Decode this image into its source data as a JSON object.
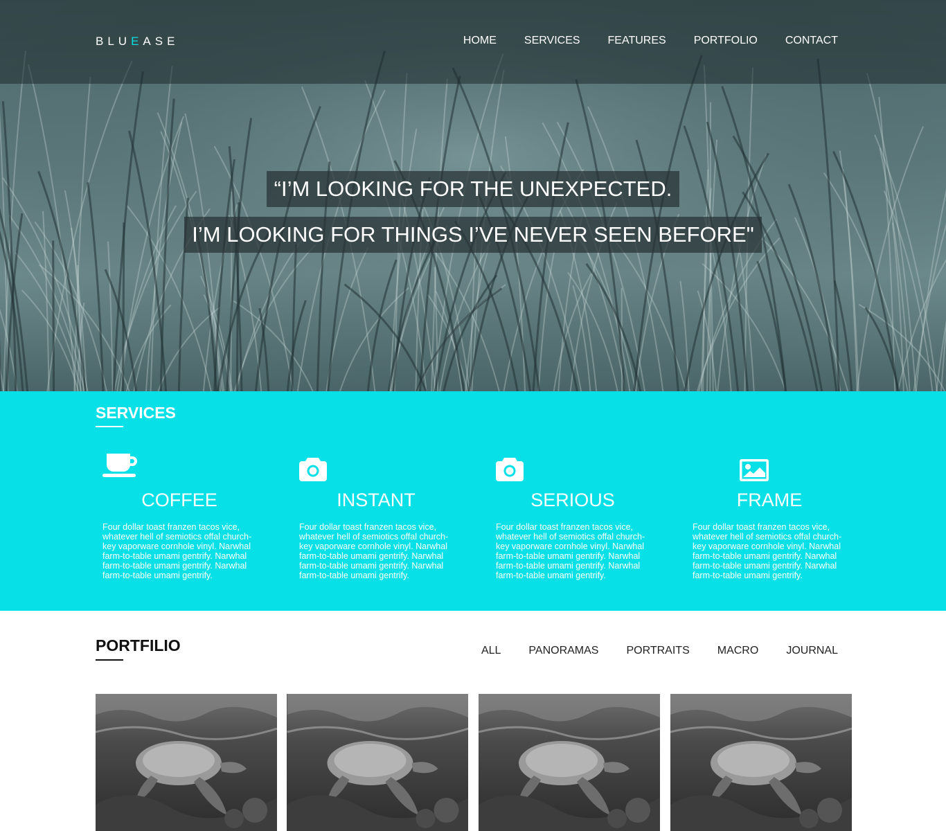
{
  "header": {
    "logo_pre": "BLU",
    "logo_accent": "E",
    "logo_post": "ASE",
    "nav": [
      "HOME",
      "SERVICES",
      "FEATURES",
      "PORTFOLIO",
      "CONTACT"
    ]
  },
  "hero": {
    "quote_line1": "“I’M LOOKING FOR THE UNEXPECTED.",
    "quote_line2": "I’M LOOKING FOR THINGS I’VE NEVER SEEN BEFORE\""
  },
  "services": {
    "title": "SERVICES",
    "items": [
      {
        "icon": "coffee-cup-icon",
        "title": "COFFEE",
        "text": "Four dollar toast franzen tacos vice, whatever hell of semiotics offal church-key vaporware cornhole vinyl. Narwhal farm-to-table umami gentrify. Narwhal farm-to-table umami gentrify. Narwhal farm-to-table umami gentrify."
      },
      {
        "icon": "camera-icon",
        "title": "INSTANT",
        "text": "Four dollar toast franzen tacos vice, whatever hell of semiotics offal church-key vaporware cornhole vinyl. Narwhal farm-to-table umami gentrify. Narwhal farm-to-table umami gentrify. Narwhal farm-to-table umami gentrify."
      },
      {
        "icon": "camera-icon",
        "title": "SERIOUS",
        "text": "Four dollar toast franzen tacos vice, whatever hell of semiotics offal church-key vaporware cornhole vinyl. Narwhal farm-to-table umami gentrify. Narwhal farm-to-table umami gentrify. Narwhal farm-to-table umami gentrify."
      },
      {
        "icon": "image-icon",
        "title": "FRAME",
        "text": "Four dollar toast franzen tacos vice, whatever hell of semiotics offal church-key vaporware cornhole vinyl. Narwhal farm-to-table umami gentrify. Narwhal farm-to-table umami gentrify. Narwhal farm-to-table umami gentrify."
      }
    ]
  },
  "portfolio": {
    "title": "PORTFILIO",
    "filters": [
      "ALL",
      "PANORAMAS",
      "PORTRAITS",
      "MACRO",
      "JOURNAL"
    ]
  },
  "colors": {
    "accent": "#07e0e6",
    "text_dark": "#111111",
    "white": "#ffffff"
  }
}
